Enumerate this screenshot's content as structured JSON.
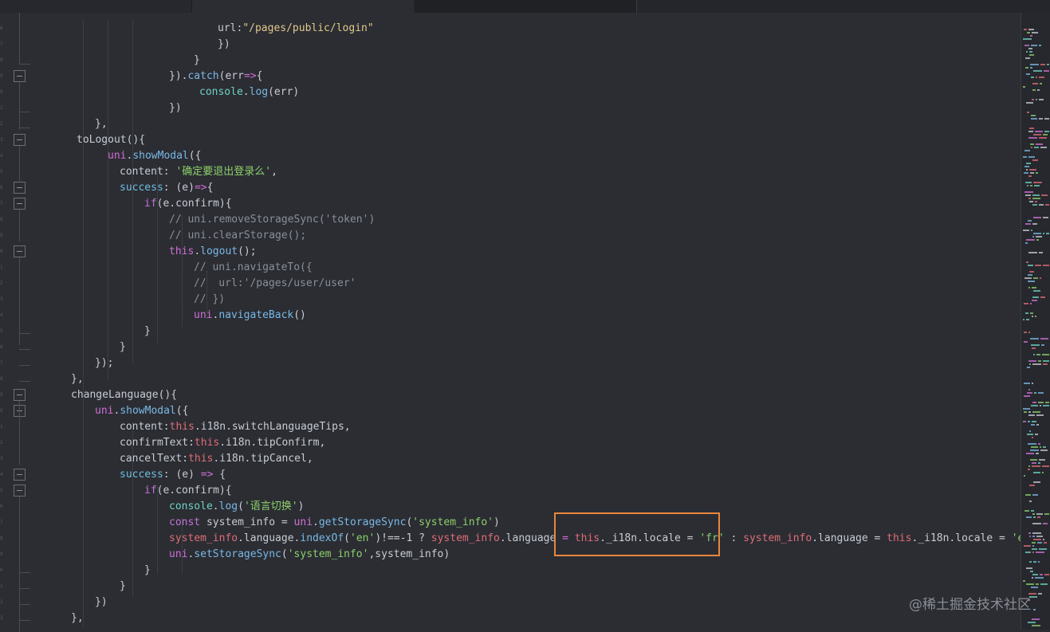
{
  "tabs": [
    {
      "label": ""
    },
    {
      "label": ""
    },
    {
      "label": ""
    }
  ],
  "watermark": "@稀土掘金技术社区",
  "code_lines": [
    [
      {
        "t": "url",
        "c": "id"
      },
      {
        "t": ":",
        "c": "p"
      },
      {
        "t": "\"/pages/public/login\"",
        "c": "s"
      }
    ],
    [
      {
        "t": "})",
        "c": "p"
      }
    ],
    [
      {
        "t": "}",
        "c": "p"
      }
    ],
    [
      {
        "t": "}).",
        "c": "p"
      },
      {
        "t": "catch",
        "c": "f"
      },
      {
        "t": "(err",
        "c": "p"
      },
      {
        "t": "=>",
        "c": "op"
      },
      {
        "t": "{",
        "c": "p"
      }
    ],
    [
      {
        "t": "console",
        "c": "cn"
      },
      {
        "t": ".",
        "c": "p"
      },
      {
        "t": "log",
        "c": "f"
      },
      {
        "t": "(err)",
        "c": "p"
      }
    ],
    [
      {
        "t": "})",
        "c": "p"
      }
    ],
    [
      {
        "t": "},",
        "c": "p"
      }
    ],
    [
      {
        "t": "toLogout",
        "c": "id"
      },
      {
        "t": "(){",
        "c": "p"
      }
    ],
    [
      {
        "t": "uni",
        "c": "m"
      },
      {
        "t": ".",
        "c": "p"
      },
      {
        "t": "showModal",
        "c": "f"
      },
      {
        "t": "({",
        "c": "p"
      }
    ],
    [
      {
        "t": "content",
        "c": "id"
      },
      {
        "t": ": ",
        "c": "p"
      },
      {
        "t": "'确定要退出登录么'",
        "c": "s2"
      },
      {
        "t": ",",
        "c": "p"
      }
    ],
    [
      {
        "t": "success",
        "c": "pr"
      },
      {
        "t": ": (e)",
        "c": "p"
      },
      {
        "t": "=>",
        "c": "op"
      },
      {
        "t": "{",
        "c": "p"
      }
    ],
    [
      {
        "t": "if",
        "c": "k"
      },
      {
        "t": "(e.confirm){",
        "c": "p"
      }
    ],
    [
      {
        "t": "// uni.removeStorageSync('token')",
        "c": "c"
      }
    ],
    [
      {
        "t": "// uni.clearStorage();",
        "c": "c"
      }
    ],
    [
      {
        "t": "this",
        "c": "m"
      },
      {
        "t": ".",
        "c": "p"
      },
      {
        "t": "logout",
        "c": "f"
      },
      {
        "t": "();",
        "c": "p"
      }
    ],
    [
      {
        "t": "// uni.navigateTo({",
        "c": "c"
      }
    ],
    [
      {
        "t": "//  url:'/pages/user/user'",
        "c": "c"
      }
    ],
    [
      {
        "t": "// })",
        "c": "c"
      }
    ],
    [
      {
        "t": "uni",
        "c": "m"
      },
      {
        "t": ".",
        "c": "p"
      },
      {
        "t": "navigateBack",
        "c": "f"
      },
      {
        "t": "()",
        "c": "p"
      }
    ],
    [
      {
        "t": "}",
        "c": "p"
      }
    ],
    [
      {
        "t": "}",
        "c": "p"
      }
    ],
    [
      {
        "t": "});",
        "c": "p"
      }
    ],
    [
      {
        "t": "},",
        "c": "p"
      }
    ],
    [
      {
        "t": "changeLanguage",
        "c": "id"
      },
      {
        "t": "(){",
        "c": "p"
      }
    ],
    [
      {
        "t": "uni",
        "c": "m"
      },
      {
        "t": ".",
        "c": "p"
      },
      {
        "t": "showModal",
        "c": "f"
      },
      {
        "t": "({",
        "c": "p"
      }
    ],
    [
      {
        "t": "content",
        "c": "id"
      },
      {
        "t": ":",
        "c": "p"
      },
      {
        "t": "this",
        "c": "t"
      },
      {
        "t": ".i18n.switchLanguageTips,",
        "c": "p"
      }
    ],
    [
      {
        "t": "confirmText",
        "c": "id"
      },
      {
        "t": ":",
        "c": "p"
      },
      {
        "t": "this",
        "c": "t"
      },
      {
        "t": ".i18n.tipConfirm,",
        "c": "p"
      }
    ],
    [
      {
        "t": "cancelText",
        "c": "id"
      },
      {
        "t": ":",
        "c": "p"
      },
      {
        "t": "this",
        "c": "t"
      },
      {
        "t": ".i18n.tipCancel,",
        "c": "p"
      }
    ],
    [
      {
        "t": "success",
        "c": "pr"
      },
      {
        "t": ": (e) ",
        "c": "p"
      },
      {
        "t": "=>",
        "c": "op"
      },
      {
        "t": " {",
        "c": "p"
      }
    ],
    [
      {
        "t": "if",
        "c": "k"
      },
      {
        "t": "(e.confirm){",
        "c": "p"
      }
    ],
    [
      {
        "t": "console",
        "c": "cn"
      },
      {
        "t": ".",
        "c": "p"
      },
      {
        "t": "log",
        "c": "f"
      },
      {
        "t": "(",
        "c": "p"
      },
      {
        "t": "'语言切换'",
        "c": "s2"
      },
      {
        "t": ")",
        "c": "p"
      }
    ],
    [
      {
        "t": "const",
        "c": "k"
      },
      {
        "t": " system_info = ",
        "c": "p"
      },
      {
        "t": "uni",
        "c": "m"
      },
      {
        "t": ".",
        "c": "p"
      },
      {
        "t": "getStorageSync",
        "c": "f"
      },
      {
        "t": "(",
        "c": "p"
      },
      {
        "t": "'system_info'",
        "c": "s2"
      },
      {
        "t": ")",
        "c": "p"
      }
    ],
    [
      {
        "t": "system_info",
        "c": "t"
      },
      {
        "t": ".language.",
        "c": "p"
      },
      {
        "t": "indexOf",
        "c": "f"
      },
      {
        "t": "(",
        "c": "p"
      },
      {
        "t": "'en'",
        "c": "s2"
      },
      {
        "t": ")!==-1 ? ",
        "c": "p"
      },
      {
        "t": "system_info",
        "c": "t"
      },
      {
        "t": ".language ",
        "c": "p"
      },
      {
        "t": "=",
        "c": "op"
      },
      {
        "t": " ",
        "c": "p"
      },
      {
        "t": "this",
        "c": "t"
      },
      {
        "t": "._i18n.locale = ",
        "c": "p"
      },
      {
        "t": "'fr'",
        "c": "s2"
      },
      {
        "t": " : ",
        "c": "p"
      },
      {
        "t": "system_info",
        "c": "t"
      },
      {
        "t": ".language = ",
        "c": "p"
      },
      {
        "t": "this",
        "c": "t"
      },
      {
        "t": "._i18n.locale = ",
        "c": "p"
      },
      {
        "t": "'en'",
        "c": "s2"
      }
    ],
    [
      {
        "t": "uni",
        "c": "m"
      },
      {
        "t": ".",
        "c": "p"
      },
      {
        "t": "setStorageSync",
        "c": "f"
      },
      {
        "t": "(",
        "c": "p"
      },
      {
        "t": "'system_info'",
        "c": "s2"
      },
      {
        "t": ",system_info)",
        "c": "p"
      }
    ],
    [
      {
        "t": "}",
        "c": "p"
      }
    ],
    [
      {
        "t": "}",
        "c": "p"
      }
    ],
    [
      {
        "t": "})",
        "c": "p"
      }
    ],
    [
      {
        "t": "},",
        "c": "p"
      }
    ]
  ]
}
